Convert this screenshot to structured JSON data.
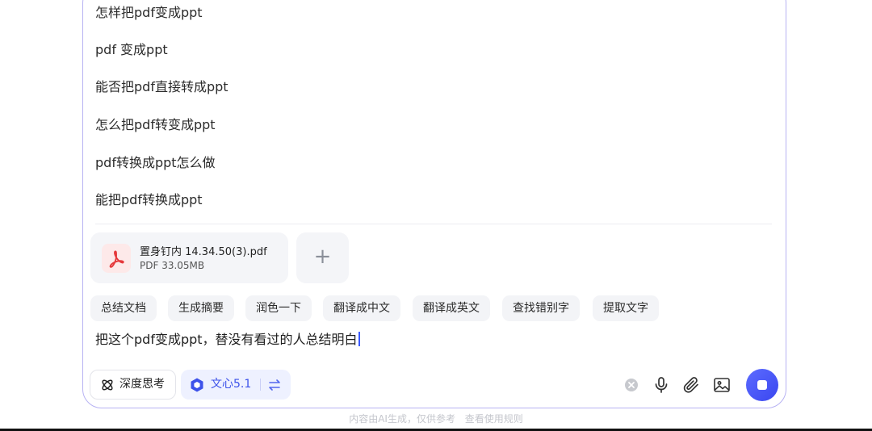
{
  "suggestions": [
    "怎样把pdf变成ppt",
    "pdf 变成ppt",
    "能否把pdf直接转成ppt",
    "怎么把pdf转变成ppt",
    "pdf转换成ppt怎么做",
    "能把pdf转换成ppt"
  ],
  "attachment": {
    "name": "置身钉内 14.34.50(3).pdf",
    "meta": "PDF  33.05MB",
    "icon": "pdf-icon"
  },
  "add_label": "+",
  "quick_actions": [
    "总结文档",
    "生成摘要",
    "润色一下",
    "翻译成中文",
    "翻译成英文",
    "查找错别字",
    "提取文字"
  ],
  "prompt_text": "把这个pdf变成ppt，替没有看过的人总结明白",
  "toolbar": {
    "deep_think_label": "深度思考",
    "model_label": "文心5.1"
  },
  "footer": {
    "disclaimer": "内容由AI生成，仅供参考",
    "rules_link": "查看使用规则"
  },
  "colors": {
    "accent": "#3d52ea",
    "panel_border": "#b7b2f3",
    "send_button": "#4552f5",
    "pdf_red": "#e5383b"
  }
}
